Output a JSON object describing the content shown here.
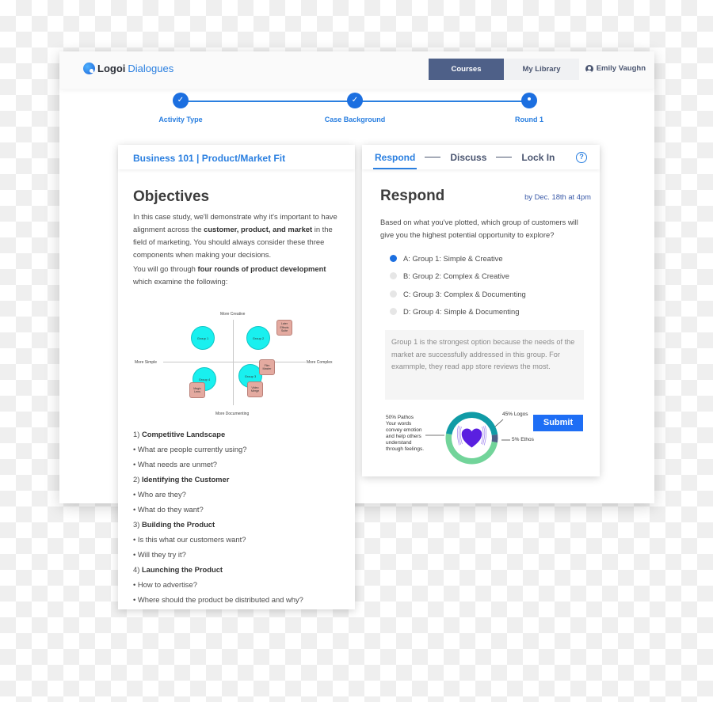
{
  "app": {
    "logo_bold": "Logoi",
    "logo_light": "Dialogues",
    "nav": [
      {
        "label": "Courses",
        "active": true
      },
      {
        "label": "My Library",
        "active": false
      }
    ],
    "user_name": "Emily Vaughn",
    "user_icon": "user-circle-icon"
  },
  "stepper": {
    "steps": [
      {
        "label": "Activity Type",
        "state": "complete",
        "icon": "check-icon"
      },
      {
        "label": "Case Background",
        "state": "complete",
        "icon": "check-icon"
      },
      {
        "label": "Round 1",
        "state": "current",
        "icon": "dot-icon"
      }
    ]
  },
  "left_card": {
    "course_title": "Business 101 | Product/Market Fit",
    "heading": "Objectives",
    "intro_1_pre": "In this case study, we'll demonstrate why it's important to have alignment across the ",
    "intro_1_bold": "customer, product, and market",
    "intro_1_post": " in the field of marketing. You should always consider these three components when making your decisions.",
    "intro_2_pre": "You will go through ",
    "intro_2_bold": "four rounds of product development",
    "intro_2_post": " which examine the following:",
    "diagram": {
      "axis_top": "More Creative",
      "axis_bottom": "More Documenting",
      "axis_left": "More Simple",
      "axis_right": "More Complex",
      "groups": [
        "Group 1",
        "Group 2",
        "Group 3",
        "Group 4"
      ],
      "products": [
        "Later Effects Suite",
        "Film Master",
        "Video Merge",
        "Magic Lens"
      ]
    },
    "rounds": [
      {
        "num": "1)",
        "title": "Competitive Landscape",
        "bullets": [
          "What are people currently using?",
          "What needs are unmet?"
        ]
      },
      {
        "num": "2)",
        "title": "Identifying the Customer",
        "bullets": [
          "Who are they?",
          "What do they want?"
        ]
      },
      {
        "num": "3)",
        "title": "Building the Product",
        "bullets": [
          "Is this what our customers want?",
          "Will they try it?"
        ]
      },
      {
        "num": "4)",
        "title": "Launching the Product",
        "bullets": [
          "How to advertise?",
          "Where should the product be distributed and why?"
        ]
      }
    ]
  },
  "right_card": {
    "tabs": [
      {
        "label": "Respond",
        "active": true
      },
      {
        "label": "Discuss",
        "active": false
      },
      {
        "label": "Lock In",
        "active": false
      }
    ],
    "help_icon": "?",
    "title": "Respond",
    "due": "by Dec. 18th at 4pm",
    "question": "Based on what you've plotted, which group of customers will give you the highest potential opportunity to explore?",
    "options": [
      {
        "label": "A: Group 1: Simple & Creative",
        "selected": true
      },
      {
        "label": "B: Group 2: Complex & Creative",
        "selected": false
      },
      {
        "label": "C: Group 3: Complex & Documenting",
        "selected": false
      },
      {
        "label": "D: Group 4: Simple & Documenting",
        "selected": false
      }
    ],
    "answer_text": "Group 1 is the strongest option because the needs of the market are successfully addressed in this group. For exammple, they read app store reviews the most.",
    "appeal": {
      "logos_label": "45% Logos",
      "ethos_label": "5% Ethos",
      "pathos_label": "50% Pathos\nYour words\nconvey emotion\nand help others\nunderstand\nthrough feelings.",
      "segments": [
        {
          "name": "Logos",
          "percent": 45,
          "color": "#109ba6"
        },
        {
          "name": "Ethos",
          "percent": 5,
          "color": "#4e6088"
        },
        {
          "name": "Pathos",
          "percent": 50,
          "color": "#72d49a"
        }
      ],
      "center_icon": "heart-icon",
      "heart_color": "#5a1fe0"
    },
    "submit_label": "Submit"
  },
  "colors": {
    "accent": "#2a7fe0",
    "nav_active": "#4e6088",
    "submit": "#1e6ef5"
  }
}
